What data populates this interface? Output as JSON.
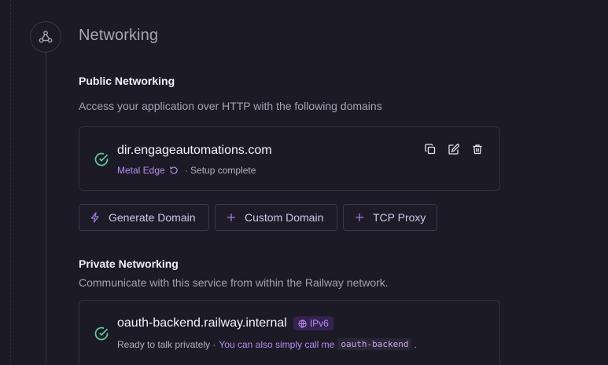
{
  "section": {
    "title": "Networking",
    "icon": "network-icon"
  },
  "public": {
    "title": "Public Networking",
    "description": "Access your application over HTTP with the following domains",
    "domain": {
      "name": "dir.engageautomations.com",
      "edge_label": "Metal Edge",
      "status": "· Setup complete",
      "status_icon": "check-circle-icon"
    },
    "actions": [
      "copy-icon",
      "edit-icon",
      "trash-icon"
    ],
    "buttons": [
      {
        "label": "Generate Domain",
        "icon": "lightning-icon"
      },
      {
        "label": "Custom Domain",
        "icon": "plus-icon"
      },
      {
        "label": "TCP Proxy",
        "icon": "plus-icon"
      }
    ]
  },
  "private": {
    "title": "Private Networking",
    "description": "Communicate with this service from within the Railway network.",
    "domain": {
      "name": "oauth-backend.railway.internal",
      "badge": "IPv6",
      "status_prefix": "Ready to talk privately ·",
      "status_link": "You can also simply call me",
      "alias": "oauth-backend",
      "suffix": "."
    }
  },
  "colors": {
    "accent": "#b48ef0",
    "success": "#5fcf9a",
    "background": "#1c1a26",
    "border": "#34303f"
  }
}
